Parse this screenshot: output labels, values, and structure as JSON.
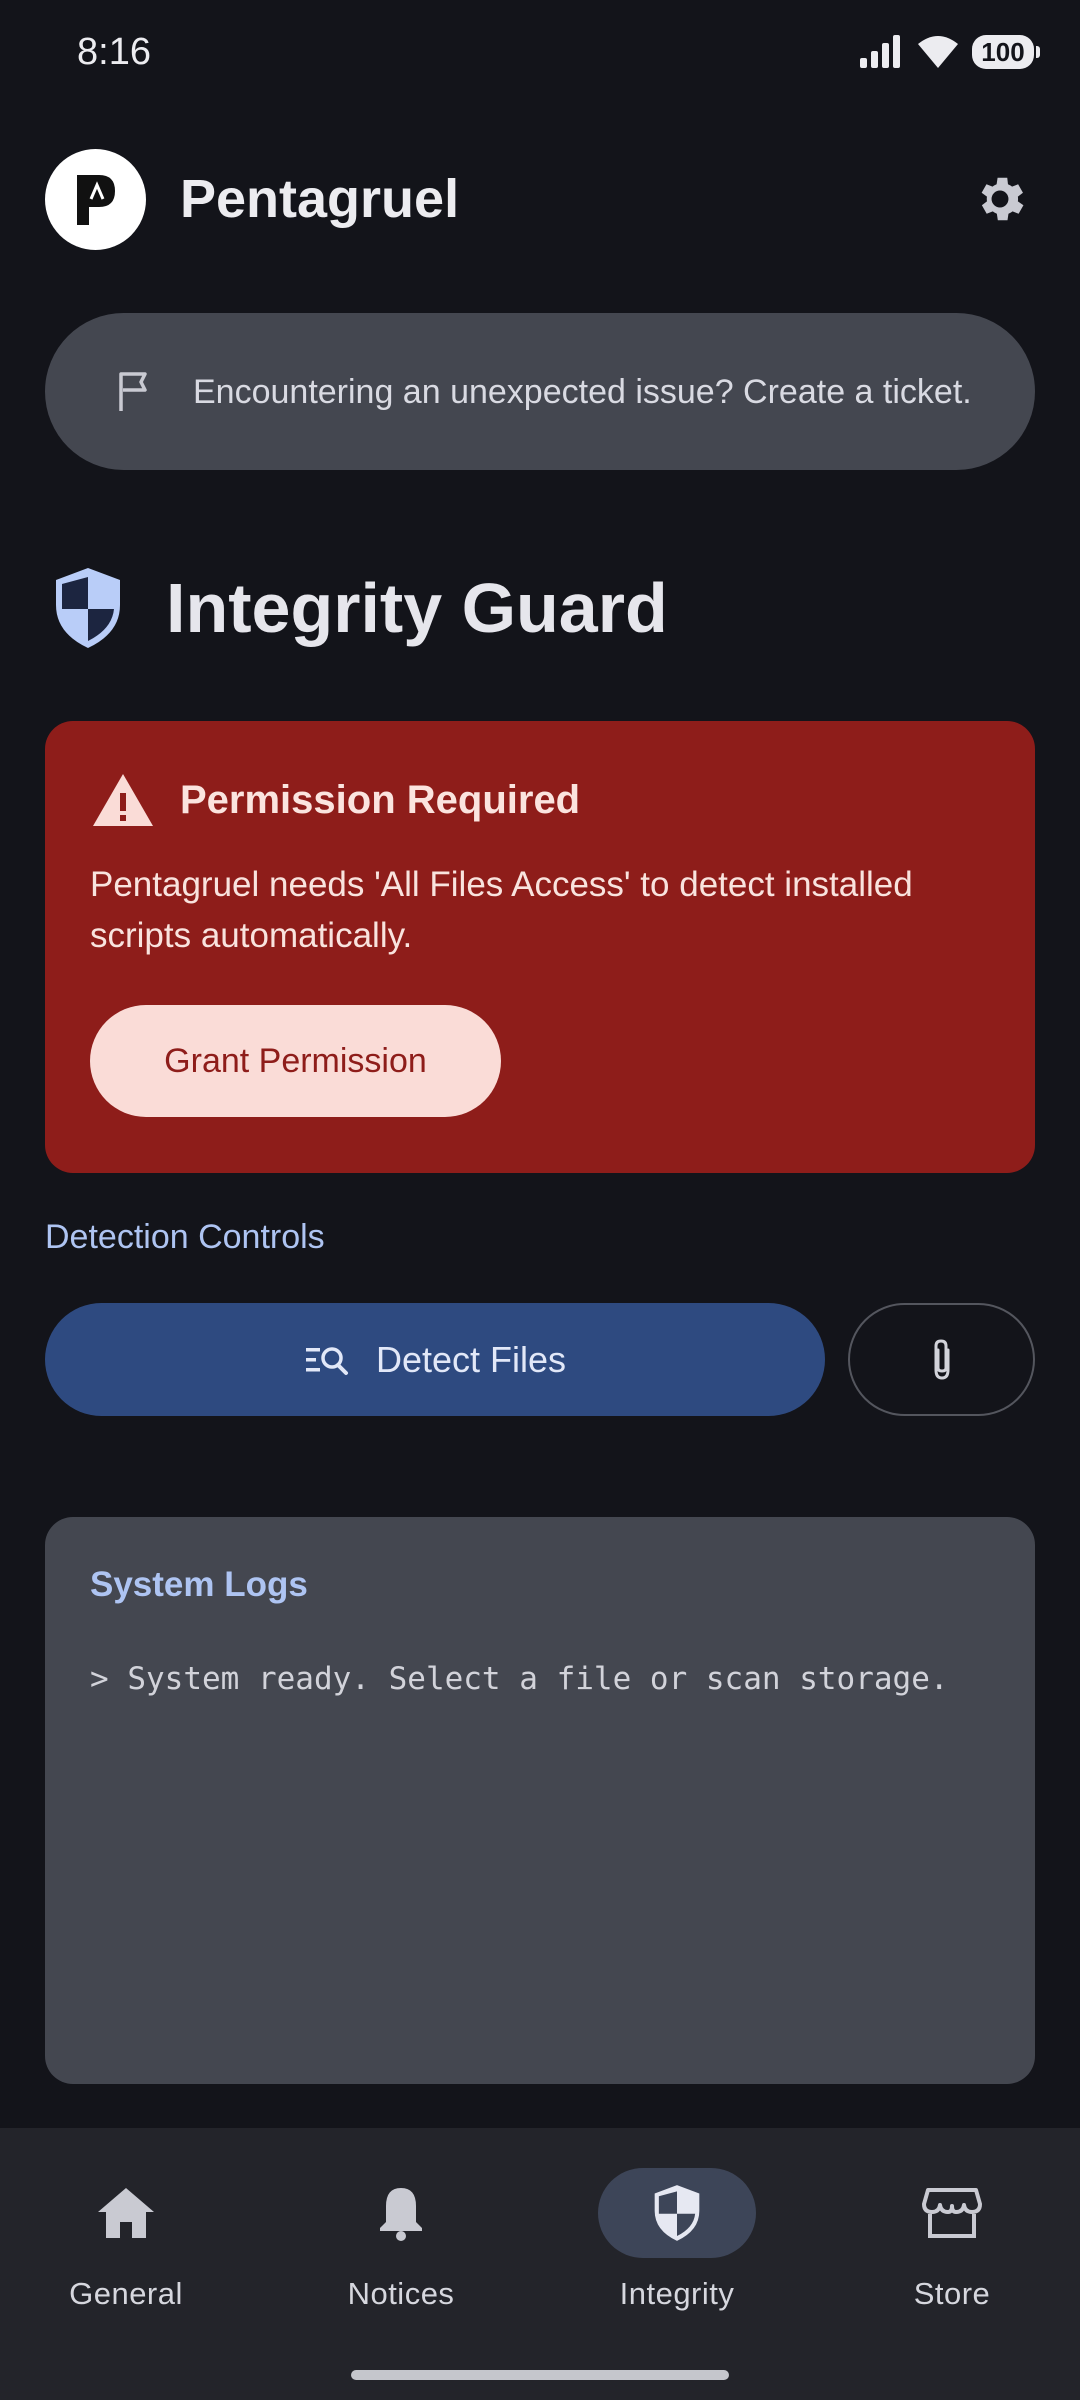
{
  "status_bar": {
    "time": "8:16",
    "battery": "100"
  },
  "header": {
    "app_name": "Pentagruel",
    "logo_letter": "P"
  },
  "ticket_banner": {
    "text": "Encountering an unexpected issue? Create a ticket."
  },
  "page": {
    "title": "Integrity Guard"
  },
  "permission_card": {
    "title": "Permission Required",
    "body": "Pentagruel needs 'All Files Access' to detect installed scripts automatically.",
    "button_label": "Grant Permission"
  },
  "detection": {
    "section_label": "Detection Controls",
    "detect_button_label": "Detect Files"
  },
  "logs": {
    "title": "System Logs",
    "lines": [
      "> System ready. Select a file or scan storage."
    ]
  },
  "bottom_nav": {
    "items": [
      {
        "label": "General",
        "icon": "home-icon",
        "active": false
      },
      {
        "label": "Notices",
        "icon": "bell-icon",
        "active": false
      },
      {
        "label": "Integrity",
        "icon": "shield-icon",
        "active": true
      },
      {
        "label": "Store",
        "icon": "store-icon",
        "active": false
      }
    ]
  },
  "colors": {
    "background": "#13141a",
    "card": "#444750",
    "danger": "#8e1d1a",
    "primary_button": "#2e4a80",
    "accent_text": "#aec4f2"
  }
}
